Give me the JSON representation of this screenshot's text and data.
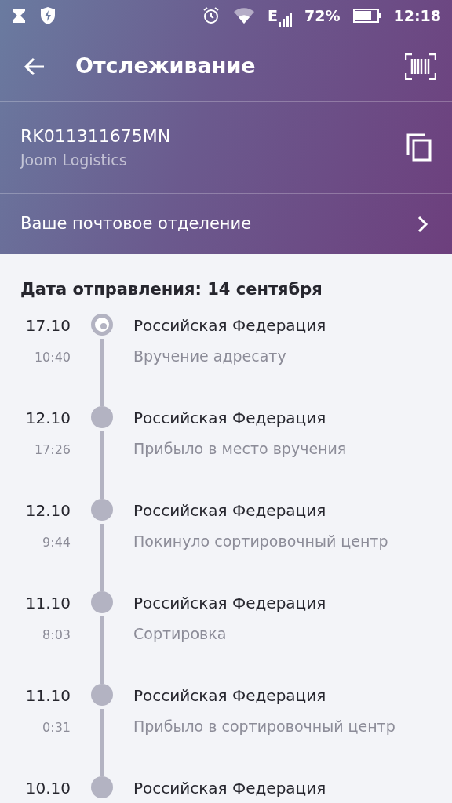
{
  "status_bar": {
    "battery_percent": "72%",
    "time": "12:18",
    "network": "E"
  },
  "toolbar": {
    "title": "Отслеживание"
  },
  "tracking": {
    "number": "RK011311675MN",
    "carrier": "Joom Logistics"
  },
  "post_office": {
    "label": "Ваше почтовое отделение"
  },
  "heading": "Дата отправления: 14 сентября",
  "events": [
    {
      "date": "17.10",
      "time": "10:40",
      "place": "Российская Федерация",
      "status": "Вручение адресату",
      "current": true
    },
    {
      "date": "12.10",
      "time": "17:26",
      "place": "Российская Федерация",
      "status": "Прибыло в место вручения",
      "current": false
    },
    {
      "date": "12.10",
      "time": "9:44",
      "place": "Российская Федерация",
      "status": "Покинуло сортировочный центр",
      "current": false
    },
    {
      "date": "11.10",
      "time": "8:03",
      "place": "Российская Федерация",
      "status": "Сортировка",
      "current": false
    },
    {
      "date": "11.10",
      "time": "0:31",
      "place": "Российская Федерация",
      "status": "Прибыло в сортировочный центр",
      "current": false
    },
    {
      "date": "10.10",
      "place": "Российская Федерация",
      "current": false
    }
  ]
}
